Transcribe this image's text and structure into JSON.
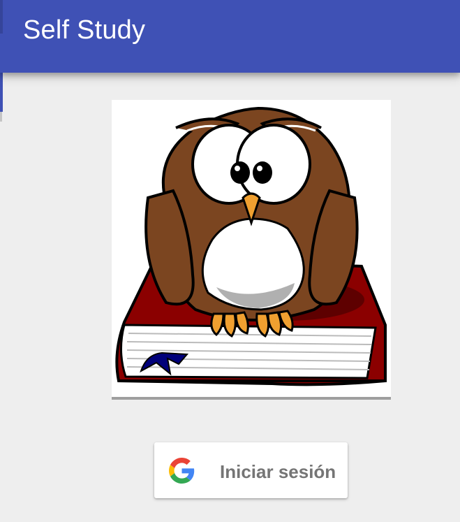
{
  "app_bar": {
    "title": "Self Study",
    "color": "#3f51b5"
  },
  "illustration": {
    "icon": "owl-on-book-illustration"
  },
  "signin": {
    "label": "Iniciar sesión",
    "icon": "google-g-icon",
    "text_color": "#757575"
  },
  "background_color": "#eeeeee"
}
